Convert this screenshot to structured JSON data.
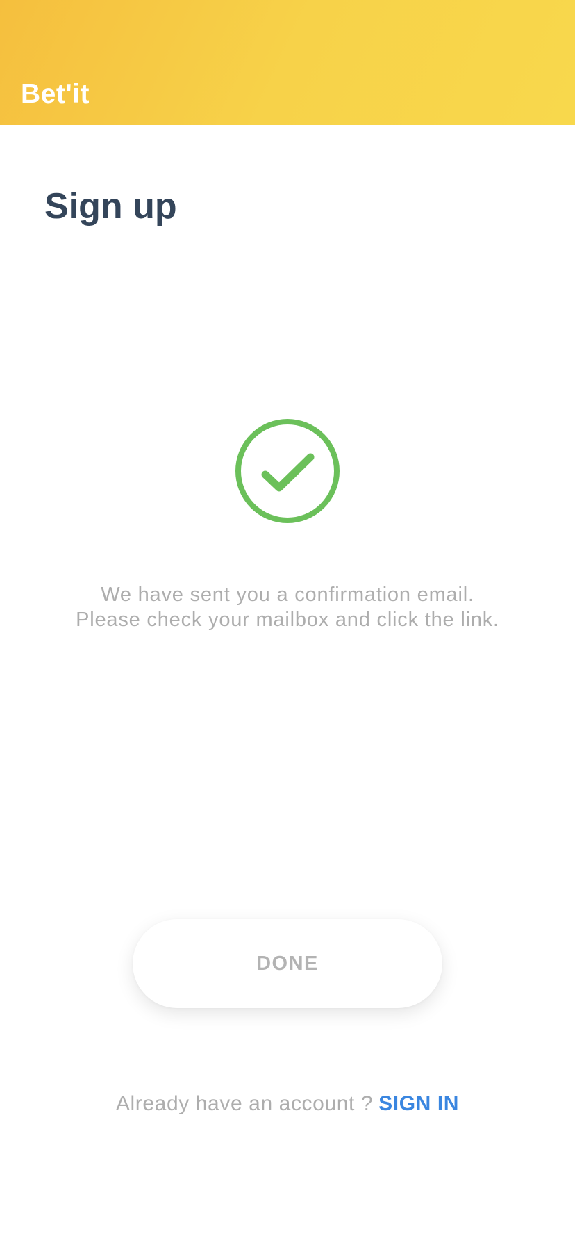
{
  "app_bar": {
    "title": "Bet'it",
    "gradient": [
      "#F5BF3E",
      "#F8D84C"
    ]
  },
  "page": {
    "title": "Sign up"
  },
  "success": {
    "icon": "check-circle-icon",
    "color": "#6BC05A",
    "message": "We have sent you a confirmation email. Please check your mailbox and click the link."
  },
  "actions": {
    "done_label": "DONE"
  },
  "footer": {
    "prompt": "Already have an account ?",
    "signin_label": "SIGN IN",
    "link_color": "#3A86E0"
  }
}
